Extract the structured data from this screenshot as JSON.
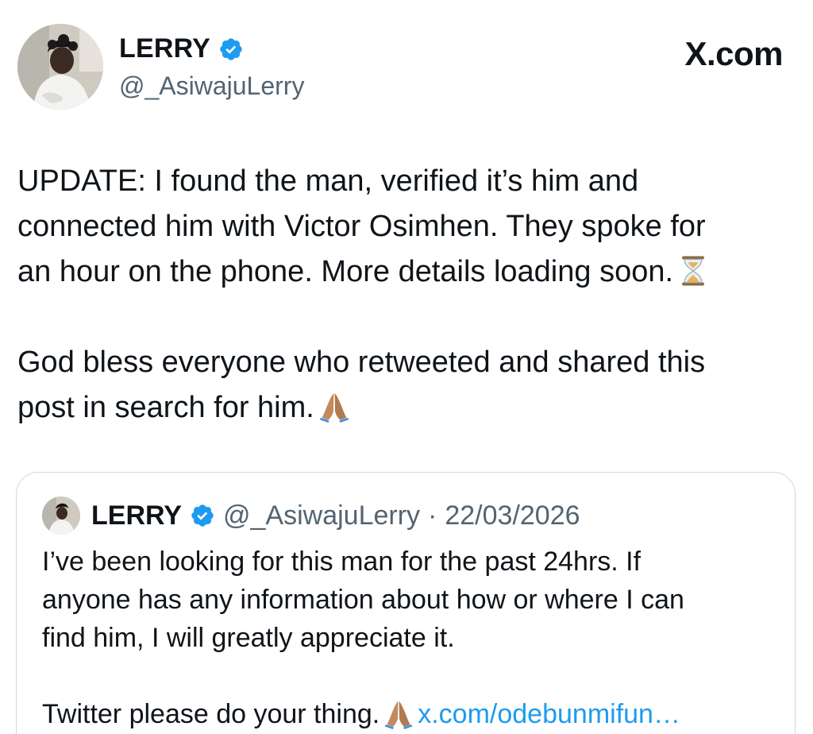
{
  "author": {
    "display_name": "LERRY",
    "handle": "@_AsiwajuLerry"
  },
  "brand": {
    "logo_text": "X.com"
  },
  "tweet": {
    "line1": "UPDATE: I found the man, verified it’s him and",
    "line2": "connected him with Victor Osimhen. They spoke for",
    "line3": "an hour on the phone. More details loading soon.",
    "line4": "God bless everyone who retweeted and shared this",
    "line5": "post in search for him."
  },
  "quoted_tweet": {
    "display_name": "LERRY",
    "handle": "@_AsiwajuLerry",
    "separator": "·",
    "date": "22/03/2026",
    "line1": "I’ve been looking for this man for the past 24hrs. If",
    "line2": "anyone has any information about how or where I can",
    "line3": "find him, I will greatly appreciate it.",
    "line4": "Twitter please do your thing.",
    "link": "x.com/odebunmifun…"
  },
  "icons": {
    "verified": "verified-badge-icon",
    "hourglass": "hourglass-emoji",
    "pray": "folded-hands-emoji"
  },
  "colors": {
    "text": "#0f1419",
    "secondary_text": "#536471",
    "verified_blue": "#1d9bf0",
    "link": "#1d9bf0",
    "border": "#cfd9de"
  }
}
